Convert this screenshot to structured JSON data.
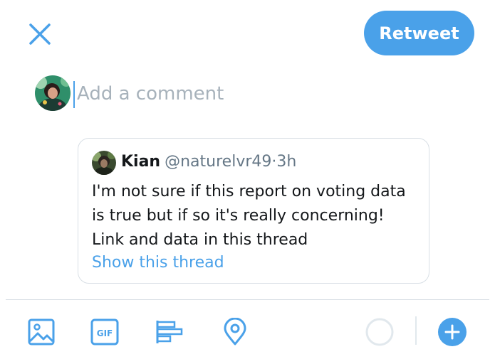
{
  "header": {
    "close_icon": "close-icon",
    "retweet_label": "Retweet"
  },
  "composer": {
    "placeholder": "Add a comment",
    "value": ""
  },
  "quoted_tweet": {
    "name": "Kian",
    "handle": "@naturelvr49",
    "separator": "·",
    "time": "3h",
    "lines": [
      "I'm not sure if this report on voting data",
      "is true but if so it's really concerning!",
      "Link and data in this thread"
    ],
    "show_thread_label": "Show this thread"
  },
  "toolbar": {
    "icons": [
      "image-icon",
      "gif-icon",
      "poll-icon",
      "location-icon",
      "progress-circle-icon",
      "add-icon"
    ],
    "gif_label": "GIF"
  },
  "colors": {
    "accent": "#4aa1e9",
    "border": "#d8dfe5",
    "secondary_text": "#657786",
    "placeholder": "#a7b2bb"
  }
}
